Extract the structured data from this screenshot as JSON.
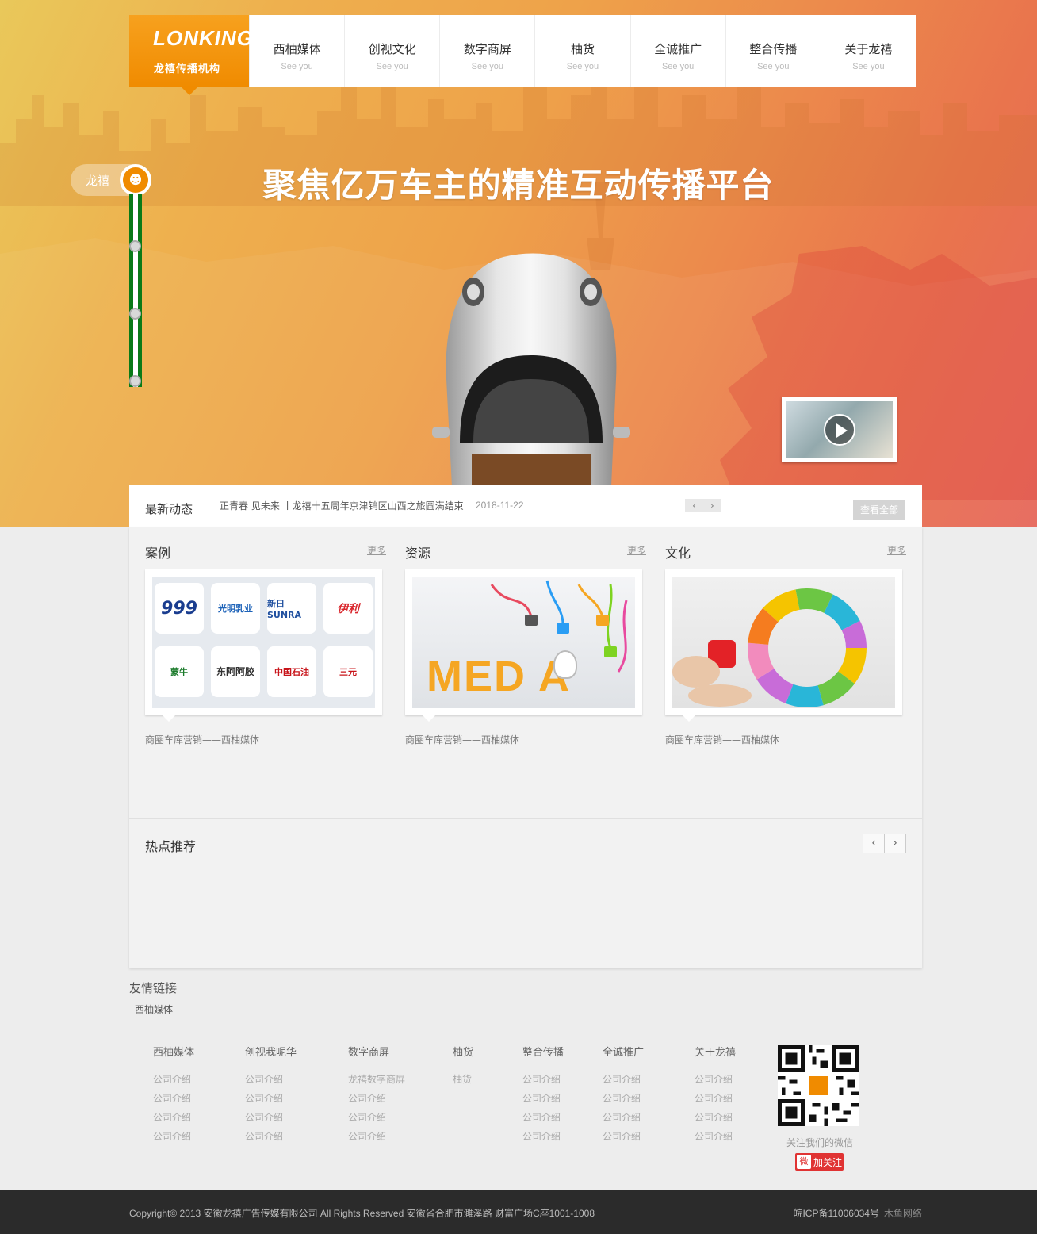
{
  "logo": {
    "mark": "LONKING",
    "sub": "龙禧传播机构"
  },
  "nav": [
    {
      "label": "西柚媒体",
      "sub": "See you"
    },
    {
      "label": "创视文化",
      "sub": "See you"
    },
    {
      "label": "数字商屏",
      "sub": "See you"
    },
    {
      "label": "柚货",
      "sub": "See you"
    },
    {
      "label": "全诚推广",
      "sub": "See you"
    },
    {
      "label": "整合传播",
      "sub": "See you"
    },
    {
      "label": "关于龙禧",
      "sub": "See you"
    }
  ],
  "timeline": {
    "label": "龙禧"
  },
  "hero": {
    "headline": "聚焦亿万车主的精准互动传播平台"
  },
  "news": {
    "title": "最新动态",
    "text": "正青春 见未来 丨龙禧十五周年京津销区山西之旅圆满结束",
    "date": "2018-11-22",
    "prev": "‹",
    "next": "›",
    "view_all": "查看全部"
  },
  "columns": [
    {
      "title": "案例",
      "more": "更多",
      "caption": "商圈车库营销——西柚媒体"
    },
    {
      "title": "资源",
      "more": "更多",
      "caption": "商圈车库营销——西柚媒体"
    },
    {
      "title": "文化",
      "more": "更多",
      "caption": "商圈车库营销——西柚媒体"
    }
  ],
  "case_logos": [
    "999",
    "光明乳业",
    "新日SUNRA",
    "伊利",
    "蒙牛",
    "东阿阿胶",
    "中国石油",
    "三元"
  ],
  "media_word": "MED  A",
  "hot": {
    "title": "热点推荐",
    "prev": "‹",
    "next": "›"
  },
  "links": {
    "title": "友情链接",
    "items": [
      "西柚媒体"
    ]
  },
  "footer_cols": [
    {
      "title": "西柚媒体",
      "items": [
        "公司介绍",
        "公司介绍",
        "公司介绍",
        "公司介绍"
      ]
    },
    {
      "title": "创视我呢华",
      "items": [
        "公司介绍",
        "公司介绍",
        "公司介绍",
        "公司介绍"
      ]
    },
    {
      "title": "数字商屏",
      "items": [
        "龙禧数字商屏",
        "公司介绍",
        "公司介绍",
        "公司介绍"
      ]
    },
    {
      "title": "柚货",
      "items": [
        "柚货"
      ]
    },
    {
      "title": "整合传播",
      "items": [
        "公司介绍",
        "公司介绍",
        "公司介绍",
        "公司介绍"
      ]
    },
    {
      "title": "全诚推广",
      "items": [
        "公司介绍",
        "公司介绍",
        "公司介绍",
        "公司介绍"
      ]
    },
    {
      "title": "关于龙禧",
      "items": [
        "公司介绍",
        "公司介绍",
        "公司介绍",
        "公司介绍"
      ]
    }
  ],
  "wechat": {
    "caption": "关注我们的微信"
  },
  "weibo": {
    "label": "加关注"
  },
  "bottom": {
    "copyright": "Copyright© 2013 安徽龙禧广告传媒有限公司 All Rights Reserved  安徽省合肥市濉溪路  财富广场C座1001-1008",
    "icp": "皖ICP备11006034号",
    "credit": "木鱼网络"
  },
  "colors": {
    "accent": "#f08b00",
    "timeline": "#0a7a18",
    "footer_bg": "#2b2b2b",
    "weibo": "#e03333"
  }
}
